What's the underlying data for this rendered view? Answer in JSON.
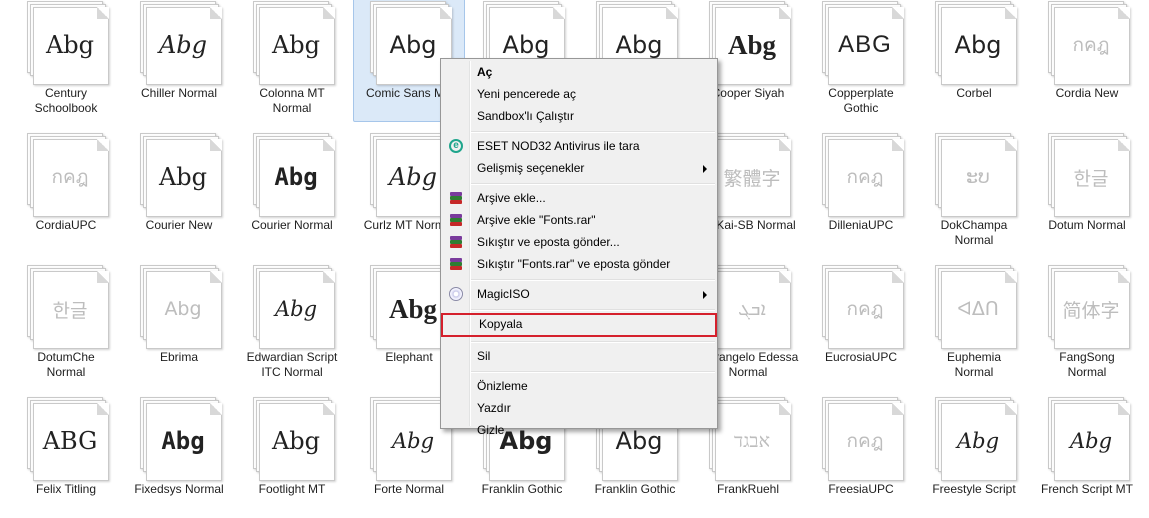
{
  "fonts": [
    {
      "label": "Century\nSchoolbook",
      "sample": "Abg",
      "style": "s-serif",
      "faded": false,
      "selected": false
    },
    {
      "label": "Chiller Normal",
      "sample": "Abg",
      "style": "s-italic",
      "faded": false,
      "selected": false
    },
    {
      "label": "Colonna MT\nNormal",
      "sample": "Abg",
      "style": "s-serif",
      "faded": false,
      "selected": false
    },
    {
      "label": "Comic Sans MS",
      "sample": "Abg",
      "style": "s-sans",
      "faded": false,
      "selected": true
    },
    {
      "label": "",
      "sample": "Abg",
      "style": "s-sans",
      "faded": false,
      "selected": false
    },
    {
      "label": "",
      "sample": "Abg",
      "style": "s-sans",
      "faded": false,
      "selected": false
    },
    {
      "label": "Cooper Siyah",
      "sample": "Abg",
      "style": "s-bold",
      "faded": false,
      "selected": false
    },
    {
      "label": "Copperplate\nGothic",
      "sample": "ABG",
      "style": "s-caps",
      "faded": false,
      "selected": false
    },
    {
      "label": "Corbel",
      "sample": "Abg",
      "style": "s-sans",
      "faded": false,
      "selected": false
    },
    {
      "label": "Cordia New",
      "sample": "กคฎ",
      "style": "s-sans",
      "faded": true,
      "selected": false
    },
    {
      "label": "CordiaUPC",
      "sample": "กคฎ",
      "style": "s-sans",
      "faded": true,
      "selected": false
    },
    {
      "label": "Courier New",
      "sample": "Abg",
      "style": "s-serif",
      "faded": false,
      "selected": false
    },
    {
      "label": "Courier Normal",
      "sample": "Abg",
      "style": "s-mono",
      "faded": false,
      "selected": false
    },
    {
      "label": "Curlz MT Normal",
      "sample": "Abg",
      "style": "s-italic",
      "faded": false,
      "selected": false
    },
    {
      "label": "",
      "sample": "",
      "style": "s-sans",
      "faded": true,
      "selected": false
    },
    {
      "label": "",
      "sample": "",
      "style": "s-sans",
      "faded": true,
      "selected": false
    },
    {
      "label": "DFKai-SB Normal",
      "sample": "繁體字",
      "style": "s-sans",
      "faded": true,
      "selected": false
    },
    {
      "label": "DilleniaUPC",
      "sample": "กคฎ",
      "style": "s-sans",
      "faded": true,
      "selected": false
    },
    {
      "label": "DokChampa\nNormal",
      "sample": "ະບ",
      "style": "s-sans",
      "faded": true,
      "selected": false
    },
    {
      "label": "Dotum Normal",
      "sample": "한글",
      "style": "s-sans",
      "faded": true,
      "selected": false
    },
    {
      "label": "DotumChe\nNormal",
      "sample": "한글",
      "style": "s-sans",
      "faded": true,
      "selected": false
    },
    {
      "label": "Ebrima",
      "sample": "Abg",
      "style": "s-sans",
      "faded": true,
      "selected": false
    },
    {
      "label": "Edwardian Script\nITC Normal",
      "sample": "Abg",
      "style": "s-script",
      "faded": false,
      "selected": false
    },
    {
      "label": "Elephant",
      "sample": "Abg",
      "style": "s-bold",
      "faded": false,
      "selected": false
    },
    {
      "label": "",
      "sample": "",
      "style": "s-sans",
      "faded": true,
      "selected": false
    },
    {
      "label": "",
      "sample": "",
      "style": "s-sans",
      "faded": true,
      "selected": false
    },
    {
      "label": "Estrangelo Edessa\nNormal",
      "sample": "ܐܒܓ",
      "style": "s-sans",
      "faded": true,
      "selected": false
    },
    {
      "label": "EucrosiaUPC",
      "sample": "กคฎ",
      "style": "s-sans",
      "faded": true,
      "selected": false
    },
    {
      "label": "Euphemia\nNormal",
      "sample": "ᐊᐃᑎ",
      "style": "s-sans",
      "faded": true,
      "selected": false
    },
    {
      "label": "FangSong\nNormal",
      "sample": "简体字",
      "style": "s-sans",
      "faded": true,
      "selected": false
    },
    {
      "label": "Felix Titling",
      "sample": "ABG",
      "style": "s-serif",
      "faded": false,
      "selected": false
    },
    {
      "label": "Fixedsys Normal",
      "sample": "Abg",
      "style": "s-mono",
      "faded": false,
      "selected": false
    },
    {
      "label": "Footlight MT",
      "sample": "Abg",
      "style": "s-serif",
      "faded": false,
      "selected": false
    },
    {
      "label": "Forte Normal",
      "sample": "Abg",
      "style": "s-script",
      "faded": false,
      "selected": false
    },
    {
      "label": "Franklin Gothic",
      "sample": "Abg",
      "style": "s-boldsans",
      "faded": false,
      "selected": false
    },
    {
      "label": "Franklin Gothic",
      "sample": "Abg",
      "style": "s-sans",
      "faded": false,
      "selected": false
    },
    {
      "label": "FrankRuehl",
      "sample": "אבגד",
      "style": "s-serif",
      "faded": true,
      "selected": false
    },
    {
      "label": "FreesiaUPC",
      "sample": "กคฎ",
      "style": "s-sans",
      "faded": true,
      "selected": false
    },
    {
      "label": "Freestyle Script",
      "sample": "Abg",
      "style": "s-script",
      "faded": false,
      "selected": false
    },
    {
      "label": "French Script MT",
      "sample": "Abg",
      "style": "s-script",
      "faded": false,
      "selected": false
    }
  ],
  "menu": {
    "items": [
      {
        "type": "item",
        "label": "Aç",
        "bold": true,
        "icon": "",
        "arrow": false,
        "hl": false
      },
      {
        "type": "item",
        "label": "Yeni pencerede aç",
        "bold": false,
        "icon": "",
        "arrow": false,
        "hl": false
      },
      {
        "type": "item",
        "label": "Sandbox'lı Çalıştır",
        "bold": false,
        "icon": "",
        "arrow": false,
        "hl": false
      },
      {
        "type": "sep"
      },
      {
        "type": "item",
        "label": "ESET NOD32 Antivirus ile tara",
        "bold": false,
        "icon": "eset-icon",
        "arrow": false,
        "hl": false
      },
      {
        "type": "item",
        "label": "Gelişmiş seçenekler",
        "bold": false,
        "icon": "",
        "arrow": true,
        "hl": false
      },
      {
        "type": "sep"
      },
      {
        "type": "item",
        "label": "Arşive ekle...",
        "bold": false,
        "icon": "winrar-icon",
        "arrow": false,
        "hl": false
      },
      {
        "type": "item",
        "label": "Arşive ekle \"Fonts.rar\"",
        "bold": false,
        "icon": "winrar-icon",
        "arrow": false,
        "hl": false
      },
      {
        "type": "item",
        "label": "Sıkıştır ve eposta gönder...",
        "bold": false,
        "icon": "winrar-icon",
        "arrow": false,
        "hl": false
      },
      {
        "type": "item",
        "label": "Sıkıştır \"Fonts.rar\" ve eposta gönder",
        "bold": false,
        "icon": "winrar-icon",
        "arrow": false,
        "hl": false
      },
      {
        "type": "sep"
      },
      {
        "type": "item",
        "label": "MagicISO",
        "bold": false,
        "icon": "magiciso-icon",
        "arrow": true,
        "hl": false
      },
      {
        "type": "sep"
      },
      {
        "type": "item",
        "label": "Kopyala",
        "bold": false,
        "icon": "",
        "arrow": false,
        "hl": true
      },
      {
        "type": "sep"
      },
      {
        "type": "item",
        "label": "Sil",
        "bold": false,
        "icon": "",
        "arrow": false,
        "hl": false
      },
      {
        "type": "sep"
      },
      {
        "type": "item",
        "label": "Önizleme",
        "bold": false,
        "icon": "",
        "arrow": false,
        "hl": false
      },
      {
        "type": "item",
        "label": "Yazdır",
        "bold": false,
        "icon": "",
        "arrow": false,
        "hl": false
      },
      {
        "type": "item",
        "label": "Gizle",
        "bold": false,
        "icon": "",
        "arrow": false,
        "hl": false
      }
    ]
  }
}
